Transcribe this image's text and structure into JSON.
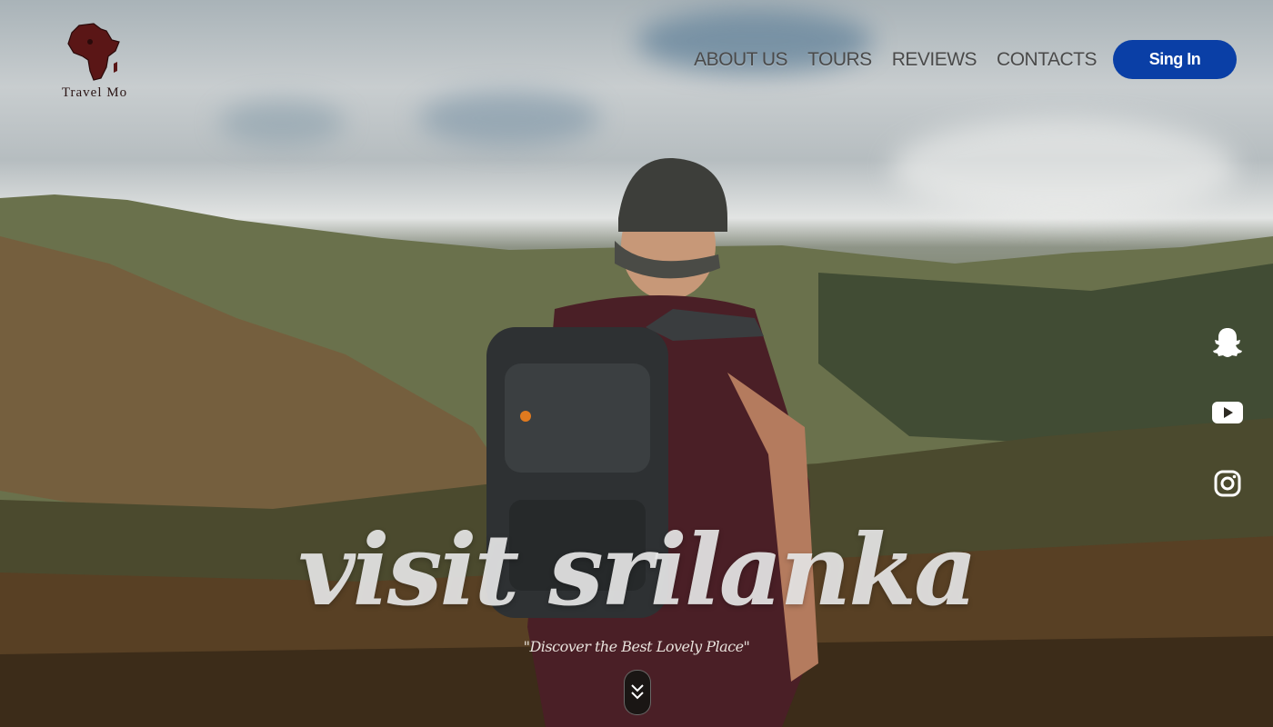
{
  "brand": {
    "logo_text": "Travel Mo",
    "logo_icon": "africa-map-icon",
    "logo_color": "#5a1616"
  },
  "nav": {
    "items": [
      {
        "label": "ABOUT US"
      },
      {
        "label": "TOURS"
      },
      {
        "label": "REVIEWS"
      },
      {
        "label": "CONTACTS"
      }
    ],
    "signin_label": "Sing In",
    "signin_color": "#0a3fa6"
  },
  "hero": {
    "title": "visit srilanka",
    "subtitle": "\"Discover the Best Lovely Place\"",
    "scroll_icon": "double-chevron-down-icon"
  },
  "social": [
    {
      "icon": "snapchat-icon"
    },
    {
      "icon": "youtube-icon"
    },
    {
      "icon": "instagram-icon"
    }
  ]
}
